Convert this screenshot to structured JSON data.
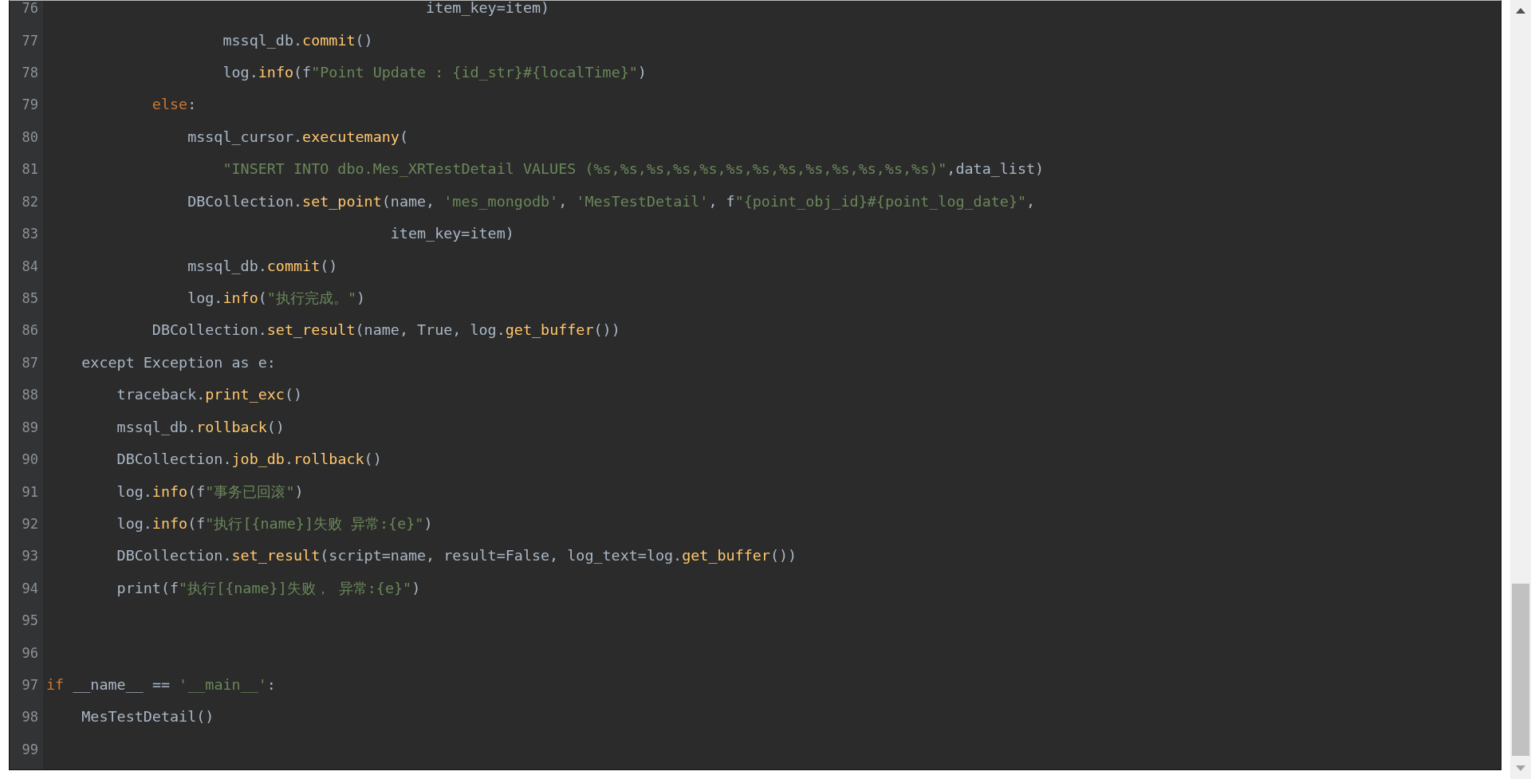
{
  "editor": {
    "lines": [
      {
        "number": "76",
        "tokens": [
          {
            "kind": "plain",
            "text": "                                           item_key=item)"
          }
        ]
      },
      {
        "number": "77",
        "tokens": [
          {
            "kind": "plain",
            "text": "                    mssql_db."
          },
          {
            "kind": "call",
            "text": "commit"
          },
          {
            "kind": "plain",
            "text": "()"
          }
        ]
      },
      {
        "number": "78",
        "tokens": [
          {
            "kind": "plain",
            "text": "                    log."
          },
          {
            "kind": "call",
            "text": "info"
          },
          {
            "kind": "plain",
            "text": "(f"
          },
          {
            "kind": "string",
            "text": "\"Point Update : {id_str}#{localTime}\""
          },
          {
            "kind": "plain",
            "text": ")"
          }
        ]
      },
      {
        "number": "79",
        "tokens": [
          {
            "kind": "keyword",
            "text": "            else"
          },
          {
            "kind": "plain",
            "text": ":"
          }
        ]
      },
      {
        "number": "80",
        "tokens": [
          {
            "kind": "plain",
            "text": "                mssql_cursor."
          },
          {
            "kind": "call",
            "text": "executemany"
          },
          {
            "kind": "plain",
            "text": "("
          }
        ]
      },
      {
        "number": "81",
        "tokens": [
          {
            "kind": "string",
            "text": "                    \"INSERT INTO dbo.Mes_XRTestDetail VALUES (%s,%s,%s,%s,%s,%s,%s,%s,%s,%s,%s,%s,%s)\""
          },
          {
            "kind": "plain",
            "text": ",data_list)"
          }
        ]
      },
      {
        "number": "82",
        "tokens": [
          {
            "kind": "plain",
            "text": "                DBCollection."
          },
          {
            "kind": "call",
            "text": "set_point"
          },
          {
            "kind": "plain",
            "text": "(name, "
          },
          {
            "kind": "string",
            "text": "'mes_mongodb'"
          },
          {
            "kind": "plain",
            "text": ", "
          },
          {
            "kind": "string",
            "text": "'MesTestDetail'"
          },
          {
            "kind": "plain",
            "text": ", f"
          },
          {
            "kind": "string",
            "text": "\"{point_obj_id}#{point_log_date}\""
          },
          {
            "kind": "plain",
            "text": ","
          }
        ]
      },
      {
        "number": "83",
        "tokens": [
          {
            "kind": "plain",
            "text": "                                       item_key=item)"
          }
        ]
      },
      {
        "number": "84",
        "tokens": [
          {
            "kind": "plain",
            "text": "                mssql_db."
          },
          {
            "kind": "call",
            "text": "commit"
          },
          {
            "kind": "plain",
            "text": "()"
          }
        ]
      },
      {
        "number": "85",
        "tokens": [
          {
            "kind": "plain",
            "text": "                log."
          },
          {
            "kind": "call",
            "text": "info"
          },
          {
            "kind": "plain",
            "text": "("
          },
          {
            "kind": "string",
            "text": "\"执行完成。\""
          },
          {
            "kind": "plain",
            "text": ")"
          }
        ]
      },
      {
        "number": "86",
        "tokens": [
          {
            "kind": "plain",
            "text": "            DBCollection."
          },
          {
            "kind": "call",
            "text": "set_result"
          },
          {
            "kind": "plain",
            "text": "(name, True, log."
          },
          {
            "kind": "call",
            "text": "get_buffer"
          },
          {
            "kind": "plain",
            "text": "())"
          }
        ]
      },
      {
        "number": "87",
        "tokens": [
          {
            "kind": "plain",
            "text": "    except Exception as e:"
          }
        ]
      },
      {
        "number": "88",
        "tokens": [
          {
            "kind": "plain",
            "text": "        traceback."
          },
          {
            "kind": "call",
            "text": "print_exc"
          },
          {
            "kind": "plain",
            "text": "()"
          }
        ]
      },
      {
        "number": "89",
        "tokens": [
          {
            "kind": "plain",
            "text": "        mssql_db."
          },
          {
            "kind": "call",
            "text": "rollback"
          },
          {
            "kind": "plain",
            "text": "()"
          }
        ]
      },
      {
        "number": "90",
        "tokens": [
          {
            "kind": "plain",
            "text": "        DBCollection."
          },
          {
            "kind": "call",
            "text": "job_db"
          },
          {
            "kind": "plain",
            "text": "."
          },
          {
            "kind": "call",
            "text": "rollback"
          },
          {
            "kind": "plain",
            "text": "()"
          }
        ]
      },
      {
        "number": "91",
        "tokens": [
          {
            "kind": "plain",
            "text": "        log."
          },
          {
            "kind": "call",
            "text": "info"
          },
          {
            "kind": "plain",
            "text": "(f"
          },
          {
            "kind": "string",
            "text": "\"事务已回滚\""
          },
          {
            "kind": "plain",
            "text": ")"
          }
        ]
      },
      {
        "number": "92",
        "tokens": [
          {
            "kind": "plain",
            "text": "        log."
          },
          {
            "kind": "call",
            "text": "info"
          },
          {
            "kind": "plain",
            "text": "(f"
          },
          {
            "kind": "string",
            "text": "\"执行[{name}]失败 异常:{e}\""
          },
          {
            "kind": "plain",
            "text": ")"
          }
        ]
      },
      {
        "number": "93",
        "tokens": [
          {
            "kind": "plain",
            "text": "        DBCollection."
          },
          {
            "kind": "call",
            "text": "set_result"
          },
          {
            "kind": "plain",
            "text": "(script=name, result=False, log_text=log."
          },
          {
            "kind": "call",
            "text": "get_buffer"
          },
          {
            "kind": "plain",
            "text": "())"
          }
        ]
      },
      {
        "number": "94",
        "tokens": [
          {
            "kind": "plain",
            "text": "        print(f"
          },
          {
            "kind": "string",
            "text": "\"执行[{name}]失败， 异常:{e}\""
          },
          {
            "kind": "plain",
            "text": ")"
          }
        ]
      },
      {
        "number": "95"
      },
      {
        "number": "96"
      },
      {
        "number": "97",
        "tokens": [
          {
            "kind": "keyword",
            "text": "if"
          },
          {
            "kind": "plain",
            "text": " __name__ == "
          },
          {
            "kind": "string",
            "text": "'__main__'"
          },
          {
            "kind": "plain",
            "text": ":"
          }
        ]
      },
      {
        "number": "98",
        "tokens": [
          {
            "kind": "plain",
            "text": "    MesTestDetail()"
          }
        ]
      },
      {
        "number": "99"
      }
    ]
  }
}
